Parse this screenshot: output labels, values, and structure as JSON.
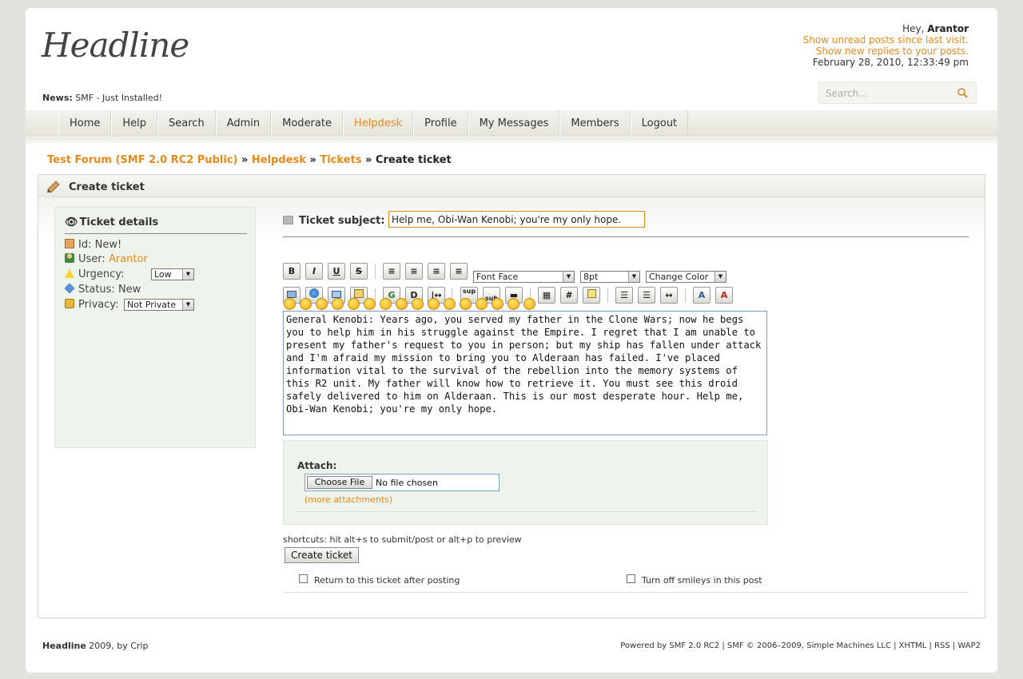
{
  "site": {
    "logo": "Headline",
    "news_label": "News:",
    "news_text": "SMF - Just Installed!"
  },
  "user": {
    "greeting": "Hey,",
    "name": "Arantor",
    "unread_link": "Show unread posts since last visit.",
    "replies_link": "Show new replies to your posts.",
    "datetime": "February 28, 2010, 12:33:49 pm"
  },
  "search": {
    "placeholder": "Search..."
  },
  "nav": {
    "items": [
      "Home",
      "Help",
      "Search",
      "Admin",
      "Moderate",
      "Helpdesk",
      "Profile",
      "My Messages",
      "Members",
      "Logout"
    ],
    "active": "Helpdesk"
  },
  "breadcrumb": {
    "items": [
      "Test Forum (SMF 2.0 RC2 Public)",
      "Helpdesk",
      "Tickets"
    ],
    "separator": "»",
    "current": "Create ticket"
  },
  "panel": {
    "title": "Create ticket"
  },
  "details": {
    "title": "Ticket details",
    "id_label": "Id:",
    "id_value": "New!",
    "user_label": "User:",
    "user_value": "Arantor",
    "urgency_label": "Urgency:",
    "urgency_value": "Low",
    "status_label": "Status:",
    "status_value": "New",
    "privacy_label": "Privacy:",
    "privacy_value": "Not Private"
  },
  "form": {
    "subject_label": "Ticket subject:",
    "subject_value": "Help me, Obi-Wan Kenobi; you're my only hope.",
    "font_face": "Font Face",
    "font_size": "8pt",
    "color": "Change Color",
    "message": "General Kenobi: Years ago, you served my father in the Clone Wars; now he begs you to help him in his struggle against the Empire. I regret that I am unable to present my father's request to you in person; but my ship has fallen under attack and I'm afraid my mission to bring you to Alderaan has failed. I've placed information vital to the survival of the rebellion into the memory systems of this R2 unit. My father will know how to retrieve it. You must see this droid safely delivered to him on Alderaan. This is our most desperate hour. Help me, Obi-Wan Kenobi; you're my only hope.",
    "attach_label": "Attach:",
    "choose_file": "Choose File",
    "no_file": "No file chosen",
    "more_attachments": "(more attachments)",
    "shortcuts": "shortcuts: hit alt+s to submit/post or alt+p to preview",
    "submit": "Create ticket",
    "return_label": "Return to this ticket after posting",
    "smileys_label": "Turn off smileys in this post"
  },
  "toolbar": {
    "bold": "B",
    "italic": "I",
    "underline": "U",
    "strike": "S",
    "glow": "G",
    "shadow": "D",
    "sup": "sup",
    "sub": "sub",
    "hash": "#"
  },
  "footer": {
    "theme": "Headline",
    "credit": " 2009, by Crip",
    "powered": "Powered by SMF 2.0 RC2 | SMF © 2006–2009, Simple Machines LLC | XHTML | RSS | WAP2"
  },
  "colors": {
    "accent": "#e8891b",
    "nav_bg": "#e9e9e2",
    "sidebar_bg": "#eef4ec"
  }
}
